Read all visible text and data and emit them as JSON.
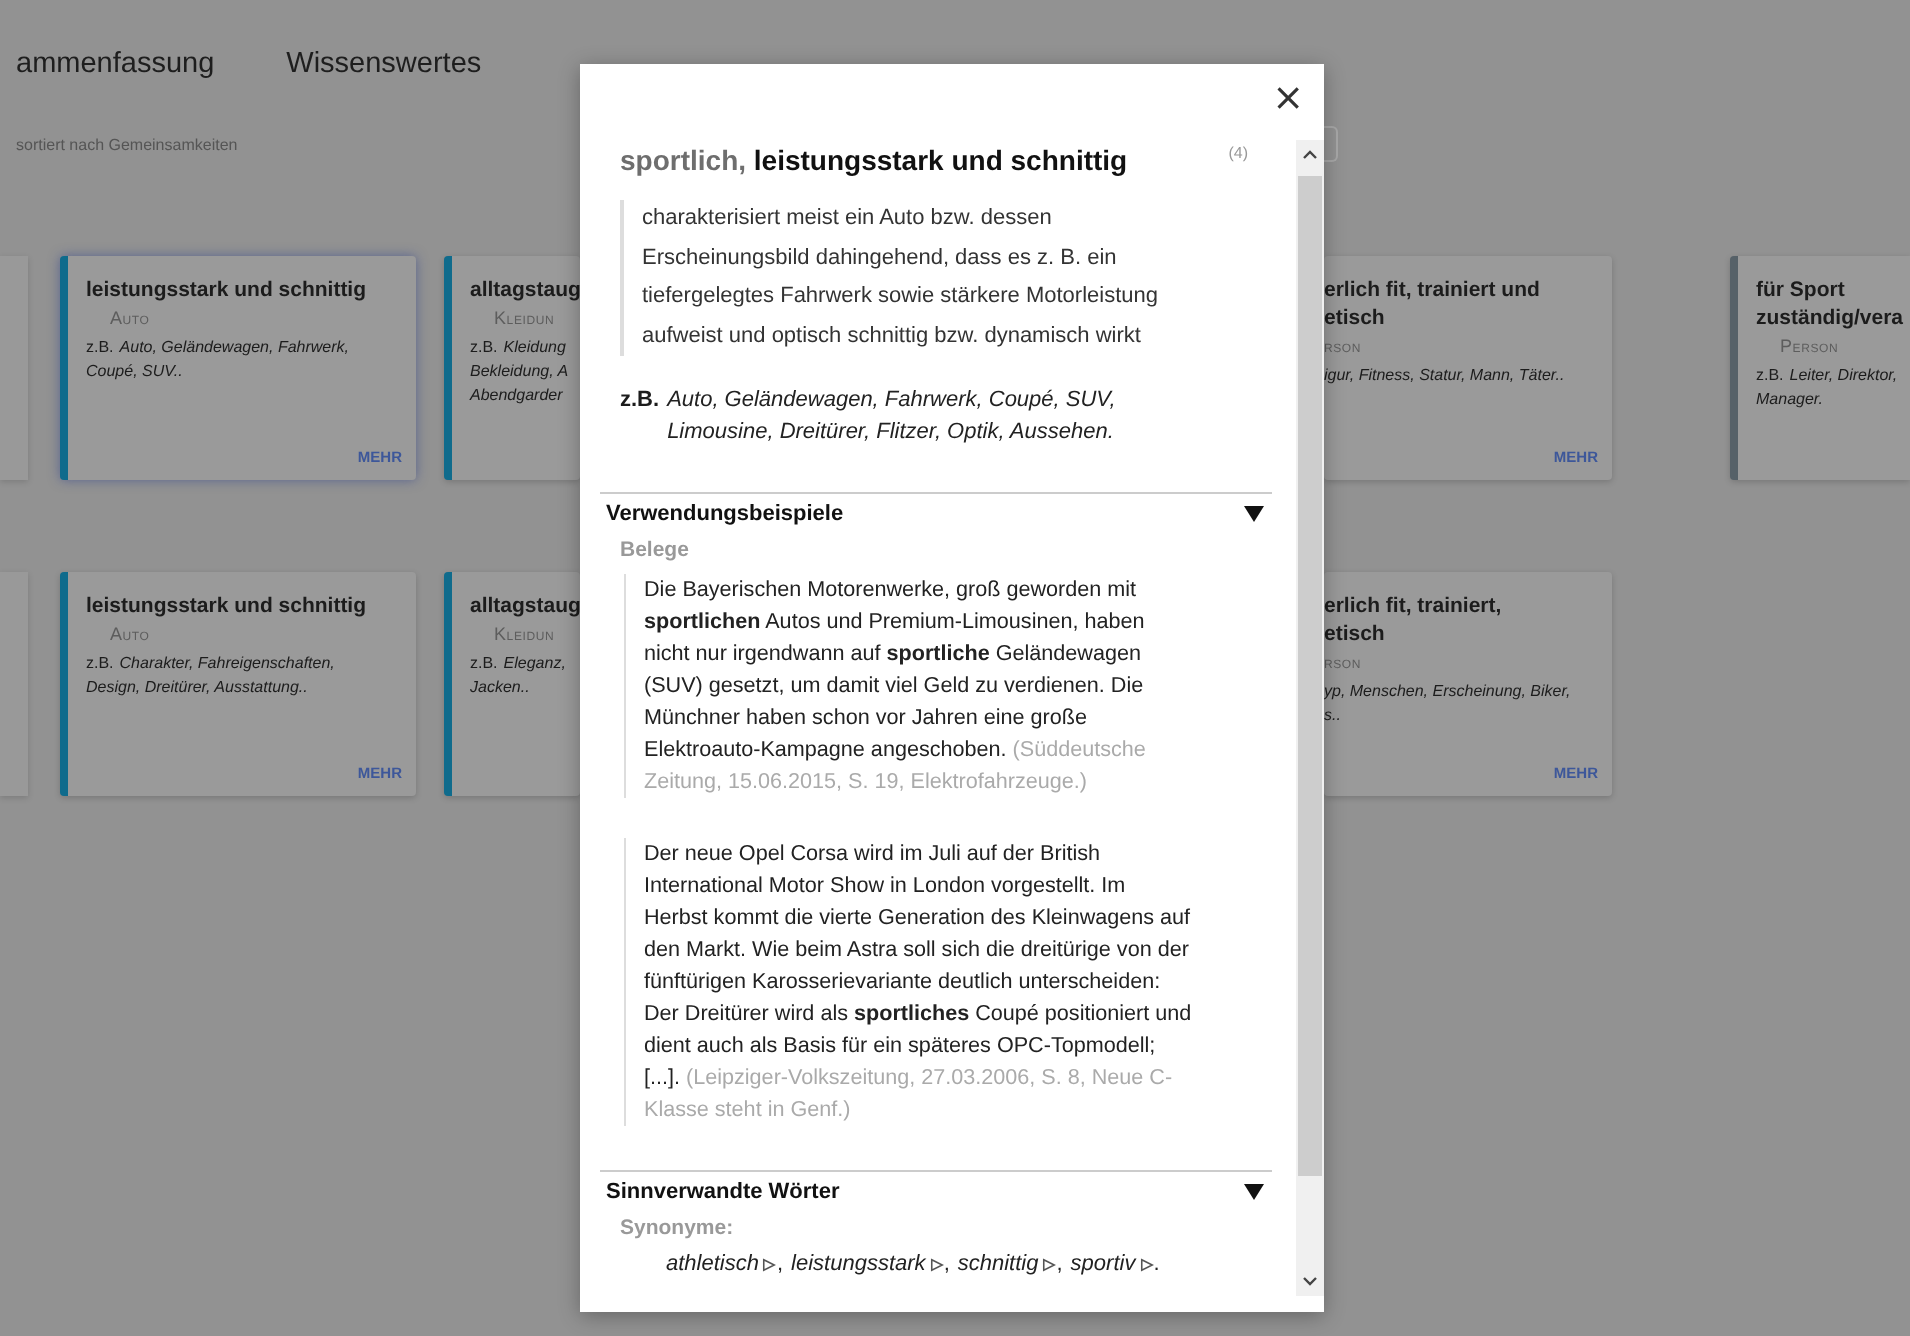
{
  "tabs": [
    {
      "label": "ammenfassung"
    },
    {
      "label": "Wissenswertes"
    }
  ],
  "sort_hint": "sortiert nach Gemeinsamkeiten",
  "card_rows": [
    {
      "cards": [
        {
          "kind": "full",
          "title_lines": [
            "leistungsstark und schnittig"
          ],
          "category": "Auto",
          "example_lead": "z.B.",
          "example_lines": [
            "Auto, Geländewagen, Fahrwerk,",
            "Coupé, SUV.."
          ],
          "more": "MEHR",
          "color": "#0f6b8c",
          "selected": true
        },
        {
          "kind": "cut-right",
          "title_lines": [
            "alltagstaug"
          ],
          "category": "Kleidun",
          "example_lead": "z.B.",
          "example_lines": [
            "Kleidung",
            "Bekleidung, A",
            "Abendgarder"
          ],
          "color": "#0f6b8c",
          "selected": false
        },
        {
          "kind": "cut-left",
          "title_lines": [
            "erlich fit, trainiert und",
            "etisch"
          ],
          "category": "rson",
          "example_lines": [
            "igur, Fitness, Statur, Mann, Täter.."
          ],
          "more": "MEHR",
          "selected": false
        },
        {
          "kind": "cut-right",
          "title_lines": [
            "für Sport",
            "zuständig/vera"
          ],
          "category": "Person",
          "example_lead": "z.B.",
          "example_lines": [
            "Leiter, Direktor,",
            "Manager."
          ],
          "color": "#566168",
          "selected": false
        }
      ]
    },
    {
      "cards": [
        {
          "kind": "full",
          "title_lines": [
            "leistungsstark und schnittig"
          ],
          "category": "Auto",
          "example_lead": "z.B.",
          "example_lines": [
            "Charakter, Fahreigenschaften,",
            "Design, Dreitürer, Ausstattung.."
          ],
          "more": "MEHR",
          "color": "#0f6b8c",
          "selected": false
        },
        {
          "kind": "cut-right",
          "title_lines": [
            "alltagstaug"
          ],
          "category": "Kleidun",
          "example_lead": "z.B.",
          "example_lines": [
            "Eleganz,",
            "Jacken.."
          ],
          "color": "#0f6b8c",
          "selected": false
        },
        {
          "kind": "cut-left",
          "title_lines": [
            "erlich fit, trainiert,",
            "etisch"
          ],
          "category": "rson",
          "example_lines": [
            "yp, Menschen, Erscheinung, Biker,",
            "s.."
          ],
          "more": "MEHR",
          "selected": false
        }
      ]
    }
  ],
  "dialog": {
    "close": "×",
    "title_prefix": "sportlich,",
    "title": "leistungsstark und schnittig",
    "count": "(4)",
    "definition": "charakterisiert meist ein Auto bzw. dessen Erscheinungsbild dahingehend, dass es z. B. ein tiefergelegtes Fahrwerk sowie stärkere Motorleistung aufweist und optisch schnittig bzw. dynamisch wirkt",
    "example_lead": "z.B.",
    "examples": "Auto, Geländewagen, Fahrwerk, Coupé, SUV, Limousine, Dreitürer, Flitzer, Optik, Aussehen.",
    "sections": [
      {
        "kind": "quotes",
        "title": "Verwendungsbeispiele",
        "expanded": true,
        "subtitle": "Belege",
        "quotes": [
          {
            "text": "Die Bayerischen Motorenwerke, groß geworden mit **sportlichen** Autos und Premium-Limousinen, haben nicht nur irgendwann auf **sportliche** Geländewagen (SUV) gesetzt, um damit viel Geld zu verdienen. Die Münchner haben schon vor Jahren eine große Elektroauto-Kampagne angeschoben.",
            "source": "(Süddeutsche Zeitung, 15.06.2015, S. 19, Elektrofahrzeuge.)"
          },
          {
            "text": "Der neue Opel Corsa wird im Juli auf der British International Motor Show in London vorgestellt. Im Herbst kommt die vierte Generation des Kleinwagens auf den Markt. Wie beim Astra soll sich die dreitürige von der fünftürigen Karosserievariante deutlich unterscheiden: Der Dreitürer wird als **sportliches** Coupé positioniert und dient auch als Basis für ein späteres OPC-Topmodell; [...].",
            "source": "(Leipziger-Volkszeitung, 27.03.2006, S. 8, Neue C-Klasse steht in Genf.)"
          }
        ]
      },
      {
        "kind": "synonyms",
        "title": "Sinnverwandte Wörter",
        "expanded": true,
        "subtitle": "Synonyme:",
        "words": [
          {
            "word": "athletisch",
            "sep": ","
          },
          {
            "word": "leistungsstark",
            "sep": ","
          },
          {
            "word": "schnittig",
            "sep": ","
          },
          {
            "word": "sportiv",
            "sep": "."
          }
        ]
      }
    ]
  }
}
